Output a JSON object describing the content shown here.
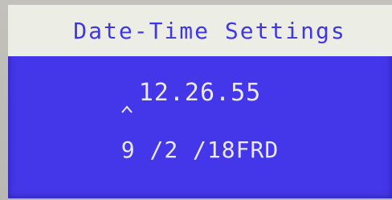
{
  "screen": {
    "title": "Date-Time Settings",
    "time": "12.26.55",
    "date": {
      "month": "9",
      "day": "2",
      "year": "18",
      "weekday": "FRD"
    }
  },
  "icons": {
    "cursor": "caret-up-icon"
  },
  "colors": {
    "title_bar_bg": "#eceee6",
    "title_text": "#3f37e6",
    "screen_bg": "#4437ea",
    "screen_text": "#ece9f6"
  }
}
